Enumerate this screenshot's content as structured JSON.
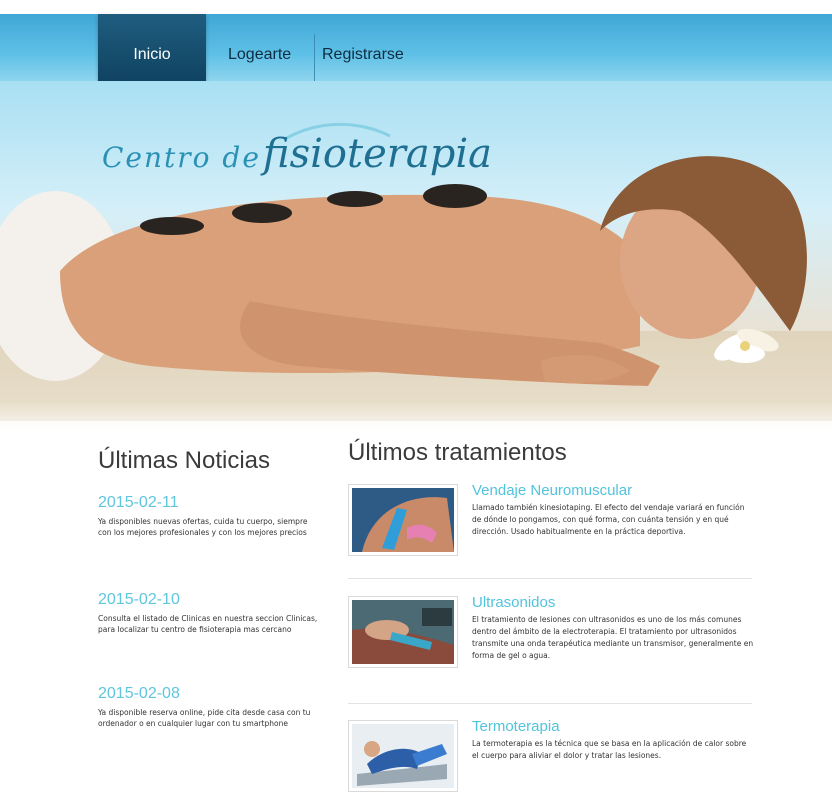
{
  "nav": {
    "items": [
      {
        "label": "Inicio",
        "active": true
      },
      {
        "label": "Logearte",
        "active": false
      },
      {
        "label": "Registrarse",
        "active": false
      }
    ]
  },
  "hero": {
    "brand_part1": "Centro de",
    "brand_part2": "fisioterapia"
  },
  "news": {
    "title": "Últimas Noticias",
    "items": [
      {
        "date": "2015-02-11",
        "text": "Ya disponibles nuevas ofertas, cuida tu cuerpo, siempre con los mejores profesionales y con los mejores precios"
      },
      {
        "date": "2015-02-10",
        "text": "Consulta el listado de Clinicas en nuestra seccion Clinicas, para localizar tu centro de fisioterapia mas cercano"
      },
      {
        "date": "2015-02-08",
        "text": "Ya disponible reserva online, pide cita desde casa con tu ordenador o en cualquier lugar con tu smartphone"
      }
    ]
  },
  "treatments": {
    "title": "Últimos tratamientos",
    "items": [
      {
        "name": "Vendaje Neuromuscular",
        "text": "Llamado también kinesiotaping. El efecto del vendaje variará en función de dónde lo pongamos, con qué forma, con cuánta tensión y en qué dirección. Usado habitualmente en la práctica deportiva."
      },
      {
        "name": "Ultrasonidos",
        "text": "El tratamiento de lesiones con ultrasonidos es uno de los más comunes dentro del ámbito de la electroterapia. El tratamiento por ultrasonidos transmite una onda terapéutica mediante un transmisor, generalmente en forma de gel o agua."
      },
      {
        "name": "Termoterapia",
        "text": "La termoterapia es la técnica que se basa en la aplicación de calor sobre el cuerpo para aliviar el dolor y tratar las lesiones."
      }
    ]
  },
  "colors": {
    "accent": "#52c3dd",
    "nav_active": "#1f5d80",
    "nav_bar": "#5ec0e6"
  }
}
